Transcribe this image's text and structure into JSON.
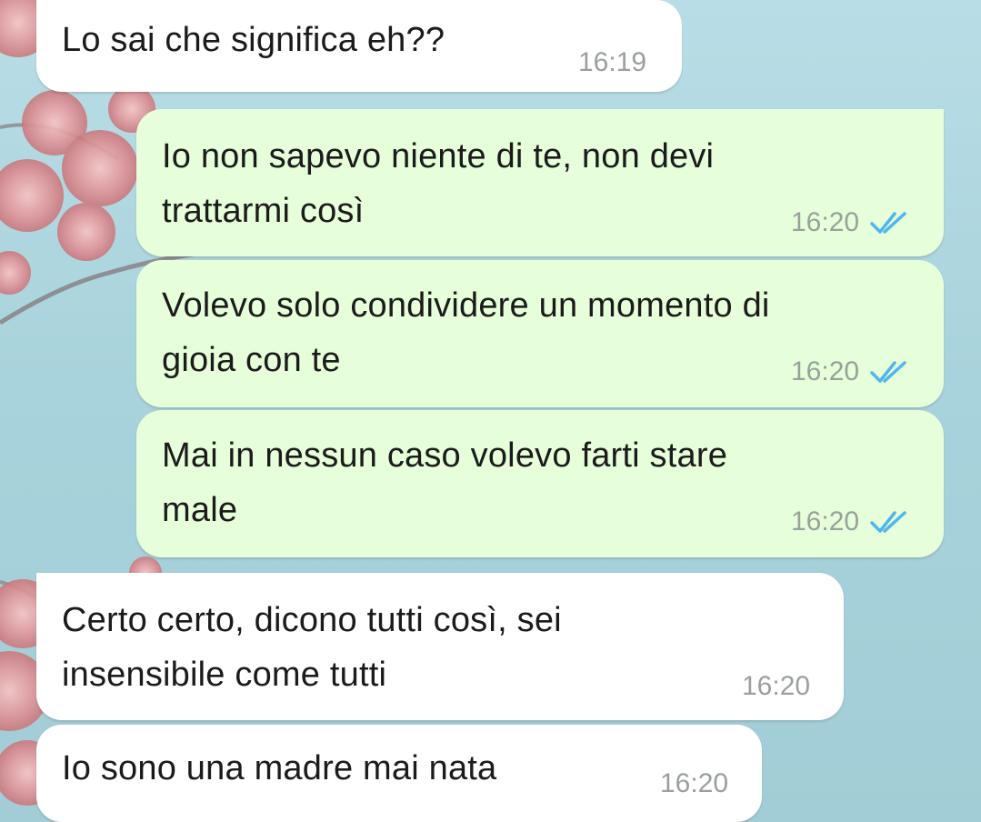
{
  "chat": {
    "messages": [
      {
        "direction": "incoming",
        "lines": [
          "Lo sai che significa eh??"
        ],
        "time": "16:19"
      },
      {
        "direction": "outgoing",
        "lines": [
          "Io non sapevo niente di te, non devi",
          "trattarmi così"
        ],
        "time": "16:20",
        "status_icon": "double-check-read-icon"
      },
      {
        "direction": "outgoing",
        "lines": [
          "Volevo solo condividere un momento di",
          "gioia con te"
        ],
        "time": "16:20",
        "status_icon": "double-check-read-icon"
      },
      {
        "direction": "outgoing",
        "lines": [
          "Mai in nessun caso volevo farti stare",
          "male"
        ],
        "time": "16:20",
        "status_icon": "double-check-read-icon"
      },
      {
        "direction": "incoming",
        "lines": [
          "Certo certo, dicono tutti così, sei",
          "insensibile come tutti"
        ],
        "time": "16:20"
      },
      {
        "direction": "incoming",
        "lines": [
          "Io sono una madre mai nata"
        ],
        "time": "16:20"
      }
    ]
  },
  "colors": {
    "incoming_bubble": "#ffffff",
    "outgoing_bubble": "#e6ffda",
    "read_ticks": "#4fb6ec",
    "timestamp": "#9aa09a"
  }
}
